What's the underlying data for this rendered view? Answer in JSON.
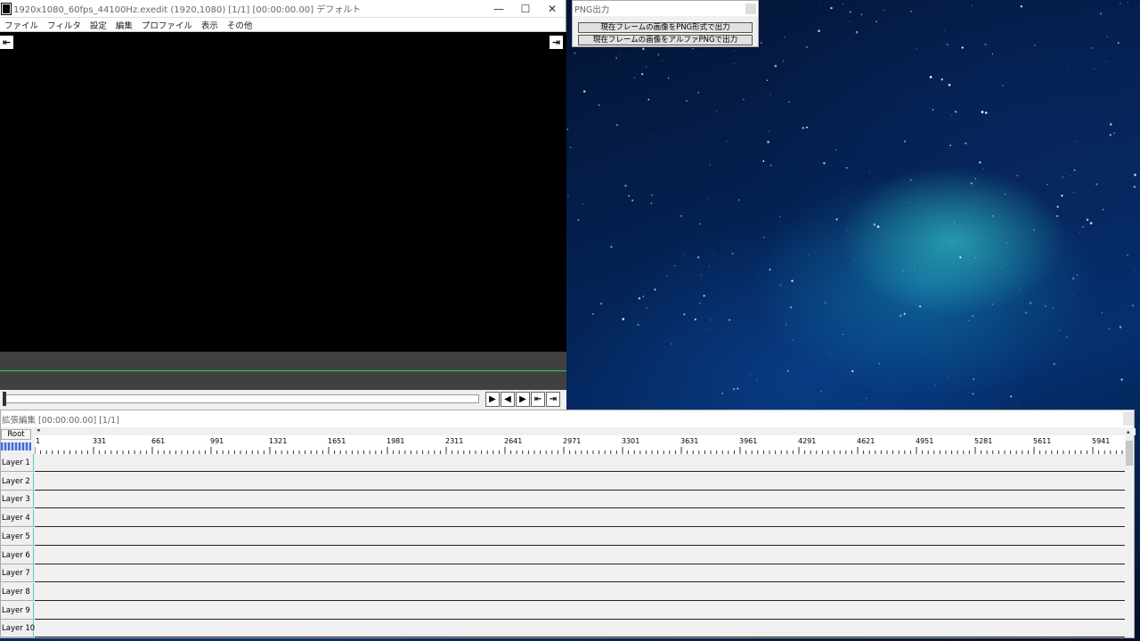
{
  "main_window": {
    "title": "1920x1080_60fps_44100Hz.exedit (1920,1080)  [1/1] [00:00:00.00]  デフォルト",
    "minimize_icon": "—",
    "maximize_icon": "☐",
    "close_icon": "✕",
    "menu": [
      "ファイル",
      "フィルタ",
      "設定",
      "編集",
      "プロファイル",
      "表示",
      "その他"
    ],
    "prev_edge_icon": "⇤",
    "next_edge_icon": "⇥",
    "playback": {
      "play": "▶",
      "prev_frame": "◀",
      "next_frame": "▶",
      "goto_start": "⇤",
      "goto_end": "⇥"
    }
  },
  "png_window": {
    "title": "PNG出力",
    "buttons": [
      "現在フレームの画像をPNG形式で出力",
      "現在フレームの画像をアルファPNGで出力"
    ]
  },
  "ext_window": {
    "title": "拡張編集 [00:00:00.00] [1/1]",
    "root_label": "Root",
    "ruler_labels": [
      "1",
      "331",
      "661",
      "991",
      "1321",
      "1651",
      "1981",
      "2311",
      "2641",
      "2971",
      "3301",
      "3631",
      "3961",
      "4291",
      "4621",
      "4951",
      "5281",
      "5611",
      "5941"
    ],
    "layers": [
      "Layer 1",
      "Layer 2",
      "Layer 3",
      "Layer 4",
      "Layer 5",
      "Layer 6",
      "Layer 7",
      "Layer 8",
      "Layer 9",
      "Layer 10"
    ]
  },
  "colors": {
    "preview_bg": "#000000",
    "strip_bg": "#404040",
    "green_line": "#39d34b",
    "layer_accent": "#5ac8c8"
  }
}
